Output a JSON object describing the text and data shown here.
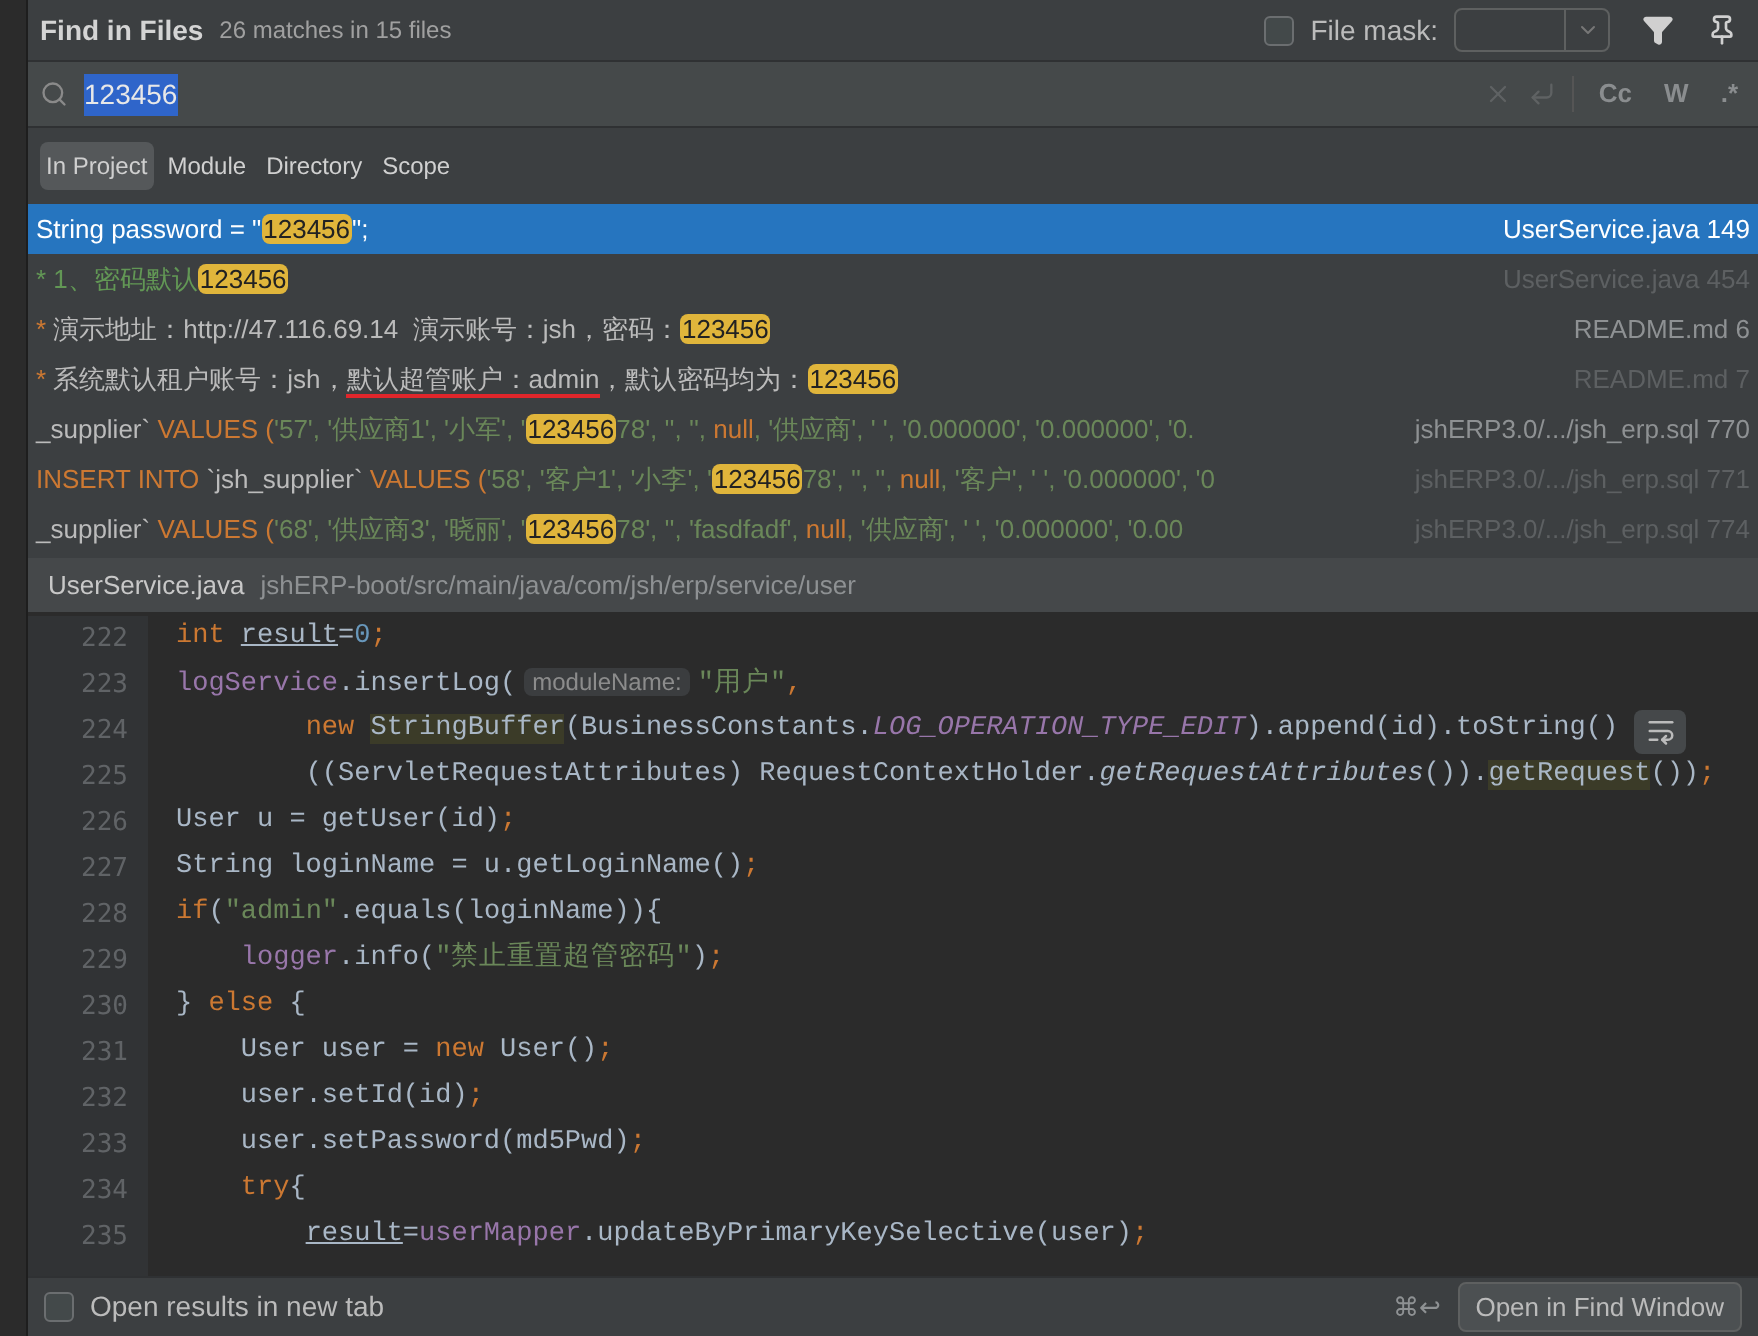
{
  "header": {
    "title": "Find in Files",
    "summary": "26 matches in 15 files",
    "file_mask": {
      "label": "File mask:",
      "checked": false
    }
  },
  "search": {
    "value": "123456",
    "selected": true,
    "toggles": [
      "Cc",
      "W",
      ".*"
    ]
  },
  "scopes": [
    {
      "label": "In Project",
      "selected": true
    },
    {
      "label": "Module",
      "selected": false
    },
    {
      "label": "Directory",
      "selected": false
    },
    {
      "label": "Scope",
      "selected": false
    }
  ],
  "results": [
    {
      "selected": true,
      "dimmed": false,
      "location": "UserService.java 149",
      "segments": [
        {
          "kind": "plain",
          "text": "String password = \""
        },
        {
          "kind": "match",
          "text": "123456"
        },
        {
          "kind": "plain",
          "text": "\";"
        }
      ]
    },
    {
      "selected": false,
      "dimmed": true,
      "location": "UserService.java 454",
      "segments": [
        {
          "kind": "comment",
          "text": "* 1、密码默认"
        },
        {
          "kind": "match",
          "text": "123456"
        }
      ]
    },
    {
      "selected": false,
      "dimmed": false,
      "location": "README.md 6",
      "segments": [
        {
          "kind": "bullet",
          "text": "* "
        },
        {
          "kind": "plain",
          "text": "演示地址：http://47.116.69.14  演示账号：jsh，密码："
        },
        {
          "kind": "match",
          "text": "123456"
        }
      ]
    },
    {
      "selected": false,
      "dimmed": true,
      "location": "README.md 7",
      "segments": [
        {
          "kind": "bullet",
          "text": "* "
        },
        {
          "kind": "plain",
          "text": "系统默认租户账号：jsh，"
        },
        {
          "kind": "underlined",
          "text": "默认超管账户：admin"
        },
        {
          "kind": "plain",
          "text": "，默认密码均为："
        },
        {
          "kind": "match",
          "text": "123456"
        }
      ]
    },
    {
      "selected": false,
      "dimmed": false,
      "location": "jshERP3.0/.../jsh_erp.sql 770",
      "segments": [
        {
          "kind": "plain",
          "text": "_supplier` "
        },
        {
          "kind": "keyword",
          "text": "VALUES ("
        },
        {
          "kind": "string",
          "text": "'57', '供应商1', '小军', '"
        },
        {
          "kind": "match",
          "text": "123456"
        },
        {
          "kind": "string",
          "text": "78', '', '', "
        },
        {
          "kind": "keyword",
          "text": "null"
        },
        {
          "kind": "string",
          "text": ", '供应商', ' ', '0.000000', '0.000000', '0."
        }
      ]
    },
    {
      "selected": false,
      "dimmed": true,
      "location": "jshERP3.0/.../jsh_erp.sql 771",
      "segments": [
        {
          "kind": "keyword",
          "text": "INSERT INTO "
        },
        {
          "kind": "plain",
          "text": "`jsh_supplier` "
        },
        {
          "kind": "keyword",
          "text": "VALUES ("
        },
        {
          "kind": "string",
          "text": "'58', '客户1', '小李', '"
        },
        {
          "kind": "match",
          "text": "123456"
        },
        {
          "kind": "string",
          "text": "78', '', '', "
        },
        {
          "kind": "keyword",
          "text": "null"
        },
        {
          "kind": "string",
          "text": ", '客户', ' ', '0.000000', '0"
        }
      ]
    },
    {
      "selected": false,
      "dimmed": true,
      "location": "jshERP3.0/.../jsh_erp.sql 774",
      "segments": [
        {
          "kind": "plain",
          "text": "_supplier` "
        },
        {
          "kind": "keyword",
          "text": "VALUES ("
        },
        {
          "kind": "string",
          "text": "'68', '供应商3', '晓丽', '"
        },
        {
          "kind": "match",
          "text": "123456"
        },
        {
          "kind": "string",
          "text": "78', '', 'fasdfadf', "
        },
        {
          "kind": "keyword",
          "text": "null"
        },
        {
          "kind": "string",
          "text": ", '供应商', ' ', '0.000000', '0.00"
        }
      ]
    }
  ],
  "preview": {
    "file": "UserService.java",
    "path": "jshERP-boot/src/main/java/com/jsh/erp/service/user",
    "lines": [
      {
        "number": "222",
        "tokens": [
          {
            "kind": "keyword",
            "text": "int "
          },
          {
            "kind": "var",
            "text": "result"
          },
          {
            "kind": "plain",
            "text": "="
          },
          {
            "kind": "number",
            "text": "0"
          },
          {
            "kind": "punct",
            "text": ";"
          }
        ]
      },
      {
        "number": "223",
        "tokens": [
          {
            "kind": "field",
            "text": "logService"
          },
          {
            "kind": "plain",
            "text": ".insertLog("
          },
          {
            "kind": "hint",
            "text": "moduleName:"
          },
          {
            "kind": "string",
            "text": "\"用户\""
          },
          {
            "kind": "punct",
            "text": ","
          }
        ]
      },
      {
        "number": "224",
        "tokens": [
          {
            "kind": "keyword",
            "text": "        new "
          },
          {
            "kind": "usage",
            "text": "StringBuffer"
          },
          {
            "kind": "plain",
            "text": "(BusinessConstants."
          },
          {
            "kind": "constant",
            "text": "LOG_OPERATION_TYPE_EDIT"
          },
          {
            "kind": "plain",
            "text": ").append(id).toString()"
          }
        ]
      },
      {
        "number": "225",
        "tokens": [
          {
            "kind": "plain",
            "text": "        ((ServletRequestAttributes) RequestContextHolder."
          },
          {
            "kind": "static",
            "text": "getRequestAttributes"
          },
          {
            "kind": "plain",
            "text": "())."
          },
          {
            "kind": "usage",
            "text": "getRequest"
          },
          {
            "kind": "plain",
            "text": "())"
          },
          {
            "kind": "punct",
            "text": ";"
          }
        ]
      },
      {
        "number": "226",
        "tokens": [
          {
            "kind": "plain",
            "text": "User u = getUser(id)"
          },
          {
            "kind": "punct",
            "text": ";"
          }
        ]
      },
      {
        "number": "227",
        "tokens": [
          {
            "kind": "plain",
            "text": "String loginName = u.getLoginName()"
          },
          {
            "kind": "punct",
            "text": ";"
          }
        ]
      },
      {
        "number": "228",
        "tokens": [
          {
            "kind": "keyword",
            "text": "if"
          },
          {
            "kind": "plain",
            "text": "("
          },
          {
            "kind": "string",
            "text": "\"admin\""
          },
          {
            "kind": "plain",
            "text": ".equals(loginName)){"
          }
        ]
      },
      {
        "number": "229",
        "tokens": [
          {
            "kind": "field",
            "text": "    logger"
          },
          {
            "kind": "plain",
            "text": ".info("
          },
          {
            "kind": "string",
            "text": "\"禁止重置超管密码\""
          },
          {
            "kind": "plain",
            "text": ")"
          },
          {
            "kind": "punct",
            "text": ";"
          }
        ]
      },
      {
        "number": "230",
        "tokens": [
          {
            "kind": "plain",
            "text": "} "
          },
          {
            "kind": "keyword",
            "text": "else"
          },
          {
            "kind": "plain",
            "text": " {"
          }
        ]
      },
      {
        "number": "231",
        "tokens": [
          {
            "kind": "plain",
            "text": "    User user = "
          },
          {
            "kind": "keyword",
            "text": "new"
          },
          {
            "kind": "plain",
            "text": " User()"
          },
          {
            "kind": "punct",
            "text": ";"
          }
        ]
      },
      {
        "number": "232",
        "tokens": [
          {
            "kind": "plain",
            "text": "    user.setId(id)"
          },
          {
            "kind": "punct",
            "text": ";"
          }
        ]
      },
      {
        "number": "233",
        "tokens": [
          {
            "kind": "plain",
            "text": "    user.setPassword(md5Pwd)"
          },
          {
            "kind": "punct",
            "text": ";"
          }
        ]
      },
      {
        "number": "234",
        "tokens": [
          {
            "kind": "keyword",
            "text": "    try"
          },
          {
            "kind": "plain",
            "text": "{"
          }
        ]
      },
      {
        "number": "235",
        "tokens": [
          {
            "kind": "var",
            "text": "        result"
          },
          {
            "kind": "plain",
            "text": "="
          },
          {
            "kind": "field",
            "text": "userMapper"
          },
          {
            "kind": "plain",
            "text": ".updateByPrimaryKeySelective(user)"
          },
          {
            "kind": "punct",
            "text": ";"
          }
        ]
      }
    ]
  },
  "footer": {
    "new_tab": {
      "label": "Open results in new tab",
      "checked": false
    },
    "shortcut": "⌘↩",
    "button": "Open in Find Window"
  }
}
